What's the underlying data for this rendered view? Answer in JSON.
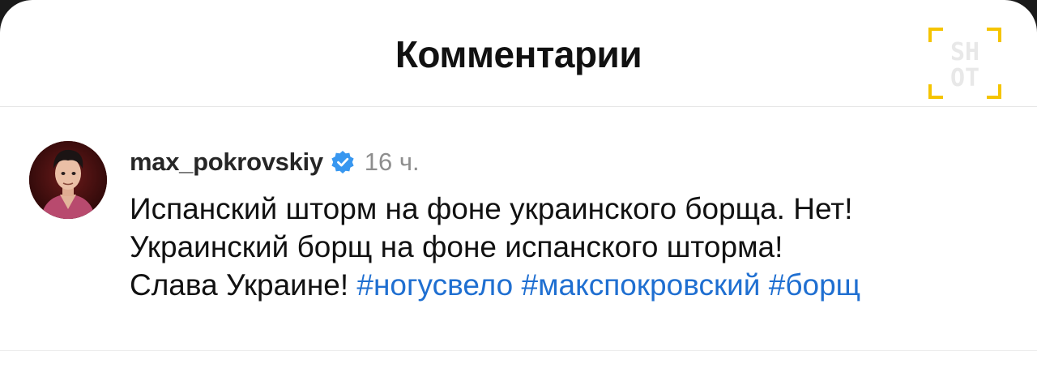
{
  "header": {
    "title": "Комментарии",
    "watermark_icon": "shot-logo-icon",
    "watermark_text_top": "SH",
    "watermark_text_bottom": "OT"
  },
  "comment": {
    "avatar_icon": "user-avatar",
    "username": "max_pokrovskiy",
    "verified_icon": "verified-badge-icon",
    "time": "16 ч.",
    "lines": [
      "Испанский шторм на фоне украинского борща. Нет!",
      "Украинский борщ на фоне испанского шторма!",
      "Слава Украине!"
    ],
    "hashtags": [
      "#ногусвело",
      "#макспокровский",
      "#борщ"
    ]
  },
  "colors": {
    "hashtag": "#1f6fd1",
    "verified": "#3897f0",
    "watermark_frame": "#f5c400"
  }
}
